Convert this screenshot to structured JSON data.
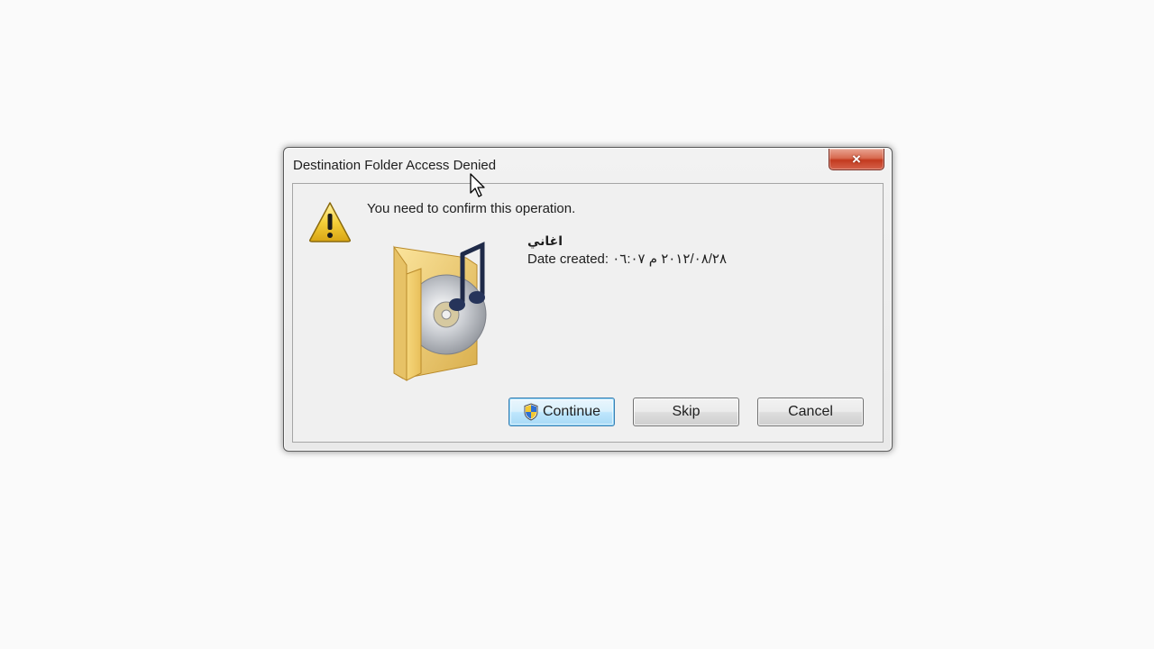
{
  "dialog": {
    "title": "Destination Folder Access Denied",
    "message": "You need to confirm this operation.",
    "file": {
      "name": "اغاني",
      "date_created": "Date created: ٢٠١٢/٠٨/٢٨ م ٠٦:٠٧"
    },
    "buttons": {
      "continue": "Continue",
      "skip": "Skip",
      "cancel": "Cancel"
    },
    "close_icon": "×"
  },
  "icons": {
    "warning": "warning-icon",
    "folder": "music-folder-icon",
    "shield": "uac-shield-icon",
    "close": "close-icon",
    "cursor": "mouse-pointer-icon"
  },
  "colors": {
    "close_button": "#c33a1f",
    "default_button_border": "#3c7fb1",
    "warning_yellow": "#f4cf3a"
  }
}
